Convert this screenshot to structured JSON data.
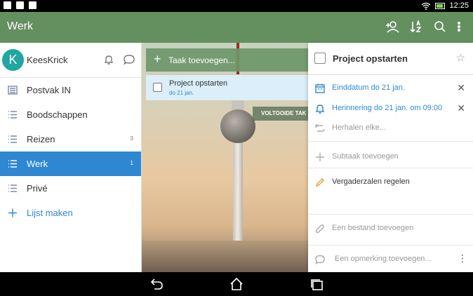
{
  "status": {
    "time": "12:25"
  },
  "appbar": {
    "title": "Werk"
  },
  "user": {
    "initial": "K",
    "name": "KeesKrick"
  },
  "lists": [
    {
      "label": "Postvak IN",
      "count": "",
      "icon": "inbox-icon"
    },
    {
      "label": "Boodschappen",
      "count": "",
      "icon": "list-icon"
    },
    {
      "label": "Reizen",
      "count": "3",
      "icon": "list-icon"
    },
    {
      "label": "Werk",
      "count": "1",
      "icon": "list-icon",
      "active": true
    },
    {
      "label": "Privé",
      "count": "",
      "icon": "list-icon"
    }
  ],
  "create_list": "Lijst maken",
  "add_task": "Taak toevoegen...",
  "task": {
    "title": "Project opstarten",
    "due": "do 21 jan."
  },
  "completed_button": "VOLTOOIDE TAK",
  "detail": {
    "title": "Project opstarten",
    "due": "Einddatum do 21 jan.",
    "reminder": "Herinnering do 21 jan. om 09:00",
    "repeat": "Herhalen elke...",
    "subtask": "Subtaak toevoegen",
    "note": "Vergaderzalen regelen",
    "file": "Een bestand toevoegen",
    "comment": "Een opmerking toevoegen..."
  },
  "colors": {
    "header": "#648f5f",
    "accent": "#2f87d2",
    "avatar": "#1fa7a0"
  }
}
